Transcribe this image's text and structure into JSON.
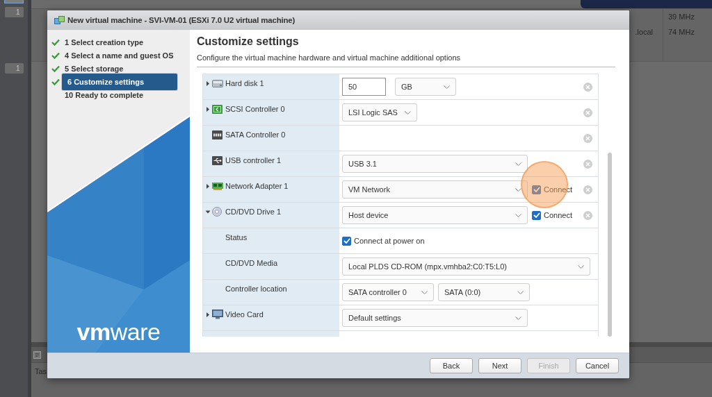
{
  "background": {
    "rail_badges": [
      "1",
      "1"
    ],
    "host_cell": ".local",
    "cpu_cells": [
      "39 MHz",
      "74 MHz"
    ],
    "panel_title": "Tas"
  },
  "dialog": {
    "title": "New virtual machine - SVI-VM-01 (ESXi 7.0 U2 virtual machine)",
    "steps": [
      {
        "label": "1 Select creation type",
        "done": true,
        "selected": false
      },
      {
        "label": "4 Select a name and guest OS",
        "done": true,
        "selected": false
      },
      {
        "label": "5 Select storage",
        "done": true,
        "selected": false
      },
      {
        "label": "6 Customize settings",
        "done": true,
        "selected": true
      },
      {
        "label": "10 Ready to complete",
        "done": false,
        "selected": false
      }
    ],
    "logo": "**vm**ware",
    "heading": "Customize settings",
    "description": "Configure the virtual machine hardware and virtual machine additional options",
    "hardware": [
      {
        "kind": "disk",
        "label": "Hard disk 1",
        "expandable": true,
        "expanded": false,
        "removable": true,
        "controls": [
          {
            "kind": "input",
            "value": "50"
          },
          {
            "kind": "unit",
            "value": "GB"
          }
        ]
      },
      {
        "kind": "scsi",
        "label": "SCSI Controller 0",
        "expandable": true,
        "expanded": false,
        "removable": true,
        "controls": [
          {
            "kind": "compact",
            "value": "LSI Logic SAS"
          }
        ]
      },
      {
        "kind": "sata",
        "label": "SATA Controller 0",
        "expandable": false,
        "expanded": false,
        "removable": true
      },
      {
        "kind": "usb",
        "label": "USB controller 1",
        "expandable": false,
        "expanded": false,
        "removable": true,
        "controls": [
          {
            "kind": "select",
            "value": "USB 3.1"
          }
        ]
      },
      {
        "kind": "network",
        "label": "Network Adapter 1",
        "expandable": true,
        "expanded": false,
        "removable": true,
        "controls": [
          {
            "kind": "select",
            "value": "VM Network"
          },
          {
            "kind": "checkbox",
            "label": "Connect",
            "checked": true,
            "highlighted": true
          }
        ]
      },
      {
        "kind": "cdrom",
        "label": "CD/DVD Drive 1",
        "expandable": true,
        "expanded": true,
        "removable": true,
        "controls": [
          {
            "kind": "select",
            "value": "Host device"
          },
          {
            "kind": "checkbox",
            "label": "Connect",
            "checked": true,
            "highlighted": false
          }
        ],
        "children": [
          {
            "label": "Status",
            "controls": [
              {
                "kind": "checkbox",
                "label": "Connect at power on",
                "checked": true,
                "highlighted": false
              }
            ]
          },
          {
            "label": "CD/DVD Media",
            "controls": [
              {
                "kind": "wide",
                "value": "Local PLDS CD-ROM (mpx.vmhba2:C0:T5:L0)"
              }
            ]
          },
          {
            "label": "Controller location",
            "controls": [
              {
                "kind": "half",
                "value": "SATA controller 0"
              },
              {
                "kind": "half",
                "value": "SATA (0:0)"
              }
            ]
          }
        ]
      },
      {
        "kind": "video",
        "label": "Video Card",
        "expandable": true,
        "expanded": false,
        "removable": false,
        "controls": [
          {
            "kind": "select",
            "value": "Default settings"
          }
        ]
      }
    ],
    "buttons": [
      {
        "label": "Back",
        "disabled": false
      },
      {
        "label": "Next",
        "disabled": false
      },
      {
        "label": "Finish",
        "disabled": true
      },
      {
        "label": "Cancel",
        "disabled": false
      }
    ]
  }
}
